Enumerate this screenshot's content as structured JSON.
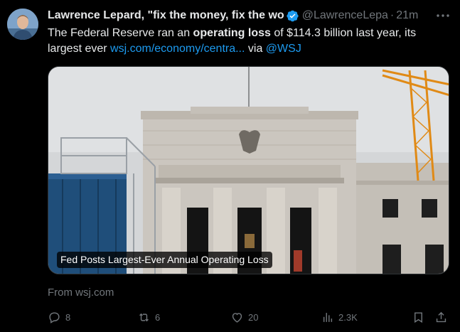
{
  "author": {
    "name": "Lawrence Lepard, \"fix the money, fix the wo",
    "handle": "@LawrenceLepa",
    "separator": "·",
    "time": "21m"
  },
  "tweet": {
    "text_part1": "The Federal Reserve ran an ",
    "text_bold": "operating loss",
    "text_part2": " of $114.3 billion last year, its largest ever ",
    "link_text": "wsj.com/economy/centra...",
    "text_part3": " via ",
    "mention": "@WSJ"
  },
  "card": {
    "title": "Fed Posts Largest-Ever Annual Operating Loss",
    "source": "From wsj.com"
  },
  "actions": {
    "replies": "8",
    "reposts": "6",
    "likes": "20",
    "views": "2.3K"
  },
  "icons": {
    "verified": "verified-badge-icon",
    "more": "more-icon",
    "reply": "reply-icon",
    "repost": "repost-icon",
    "like": "heart-icon",
    "views": "views-icon",
    "bookmark": "bookmark-icon",
    "share": "share-icon"
  },
  "colors": {
    "background": "#000000",
    "text": "#e7e9ea",
    "muted": "#71767b",
    "accent": "#1d9bf0"
  }
}
